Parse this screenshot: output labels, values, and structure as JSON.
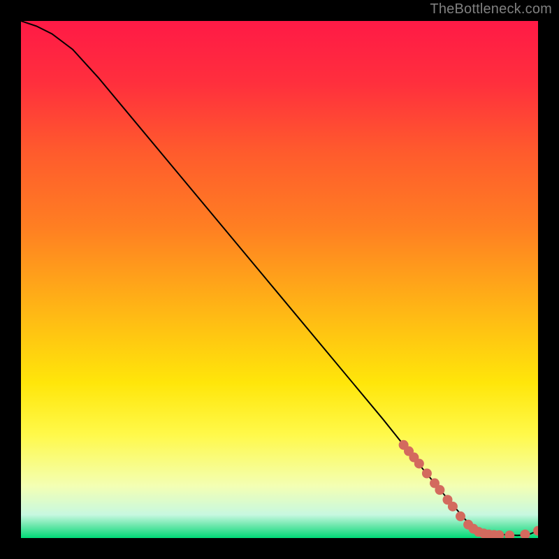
{
  "attribution": "TheBottleneck.com",
  "colors": {
    "bg": "#000000",
    "attribution_text": "#808080",
    "marker_fill": "#d36a5e",
    "curve": "#000000",
    "gradient_stops": [
      {
        "offset": 0.0,
        "color": "#ff1a46"
      },
      {
        "offset": 0.12,
        "color": "#ff2f3d"
      },
      {
        "offset": 0.25,
        "color": "#ff5a2d"
      },
      {
        "offset": 0.4,
        "color": "#ff7f22"
      },
      {
        "offset": 0.55,
        "color": "#ffb316"
      },
      {
        "offset": 0.7,
        "color": "#ffe60a"
      },
      {
        "offset": 0.8,
        "color": "#fff94a"
      },
      {
        "offset": 0.9,
        "color": "#f3ffb4"
      },
      {
        "offset": 0.955,
        "color": "#c7f8e0"
      },
      {
        "offset": 0.978,
        "color": "#63e6a7"
      },
      {
        "offset": 1.0,
        "color": "#00d977"
      }
    ]
  },
  "chart_data": {
    "type": "line",
    "title": "",
    "xlabel": "",
    "ylabel": "",
    "xlim": [
      0,
      100
    ],
    "ylim": [
      0,
      100
    ],
    "grid": false,
    "legend": false,
    "series": [
      {
        "name": "curve",
        "x": [
          0,
          3,
          6,
          10,
          15,
          20,
          30,
          40,
          50,
          60,
          70,
          78,
          83,
          86,
          88,
          90,
          92,
          94,
          96,
          98,
          100
        ],
        "y": [
          100,
          99,
          97.5,
          94.5,
          89,
          83,
          71,
          59,
          47,
          35,
          23,
          13,
          7,
          3.5,
          2,
          1.2,
          0.8,
          0.6,
          0.5,
          0.6,
          1.4
        ]
      }
    ],
    "markers": [
      {
        "x": 74.0,
        "y": 18.0
      },
      {
        "x": 75.0,
        "y": 16.8
      },
      {
        "x": 76.0,
        "y": 15.6
      },
      {
        "x": 77.0,
        "y": 14.4
      },
      {
        "x": 78.5,
        "y": 12.5
      },
      {
        "x": 80.0,
        "y": 10.6
      },
      {
        "x": 81.0,
        "y": 9.3
      },
      {
        "x": 82.5,
        "y": 7.4
      },
      {
        "x": 83.5,
        "y": 6.1
      },
      {
        "x": 85.0,
        "y": 4.2
      },
      {
        "x": 86.5,
        "y": 2.6
      },
      {
        "x": 87.5,
        "y": 1.8
      },
      {
        "x": 88.5,
        "y": 1.2
      },
      {
        "x": 89.5,
        "y": 0.9
      },
      {
        "x": 90.5,
        "y": 0.7
      },
      {
        "x": 91.5,
        "y": 0.6
      },
      {
        "x": 92.5,
        "y": 0.55
      },
      {
        "x": 94.5,
        "y": 0.5
      },
      {
        "x": 97.5,
        "y": 0.7
      },
      {
        "x": 100.0,
        "y": 1.4
      }
    ]
  }
}
